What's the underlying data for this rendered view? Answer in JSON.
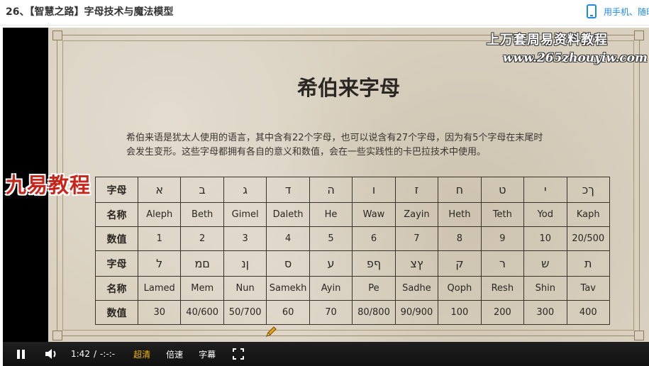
{
  "header": {
    "course_title": "26、【智慧之路】字母技术与魔法模型",
    "mobile_text": "用手机、随时",
    "accent": "#1e88e5"
  },
  "watermarks": {
    "line1": "上万套周易资料教程",
    "line2": "www.265zhouyiw.com",
    "logo": "九易教程"
  },
  "slide": {
    "title": "希伯来字母",
    "desc_line1": "希伯来语是犹太人使用的语言，其中含有22个字母，也可以说含有27个字母，因为有5个字母在末尾时",
    "desc_line2": "会发生变形。这些字母都拥有各自的意义和数值，会在一些实践性的卡巴拉技术中使用。"
  },
  "table": {
    "row_headers": {
      "letter": "字母",
      "name": "名称",
      "value": "数值"
    },
    "part1": {
      "letters": [
        "א",
        "ב",
        "ג",
        "ד",
        "ה",
        "ו",
        "ז",
        "ח",
        "ט",
        "י",
        "ךכ"
      ],
      "names": [
        "Aleph",
        "Beth",
        "Gimel",
        "Daleth",
        "He",
        "Waw",
        "Zayin",
        "Heth",
        "Teth",
        "Yod",
        "Kaph"
      ],
      "values": [
        "1",
        "2",
        "3",
        "4",
        "5",
        "6",
        "7",
        "8",
        "9",
        "10",
        "20/500"
      ]
    },
    "part2": {
      "letters": [
        "ל",
        "םמ",
        "ןנ",
        "ס",
        "ע",
        "ףפ",
        "ץצ",
        "ק",
        "ר",
        "ש",
        "ת"
      ],
      "names": [
        "Lamed",
        "Mem",
        "Nun",
        "Samekh",
        "Ayin",
        "Pe",
        "Sadhe",
        "Qoph",
        "Resh",
        "Shin",
        "Tav"
      ],
      "values": [
        "30",
        "40/600",
        "50/700",
        "60",
        "70",
        "80/800",
        "90/900",
        "100",
        "200",
        "300",
        "400"
      ]
    }
  },
  "player": {
    "time_current": "1:42",
    "time_sep": "/",
    "time_total": "-:-:-",
    "quality_label": "超清",
    "speed_label": "倍速",
    "subtitle_label": "字幕",
    "quality_color": "#f5b800"
  }
}
